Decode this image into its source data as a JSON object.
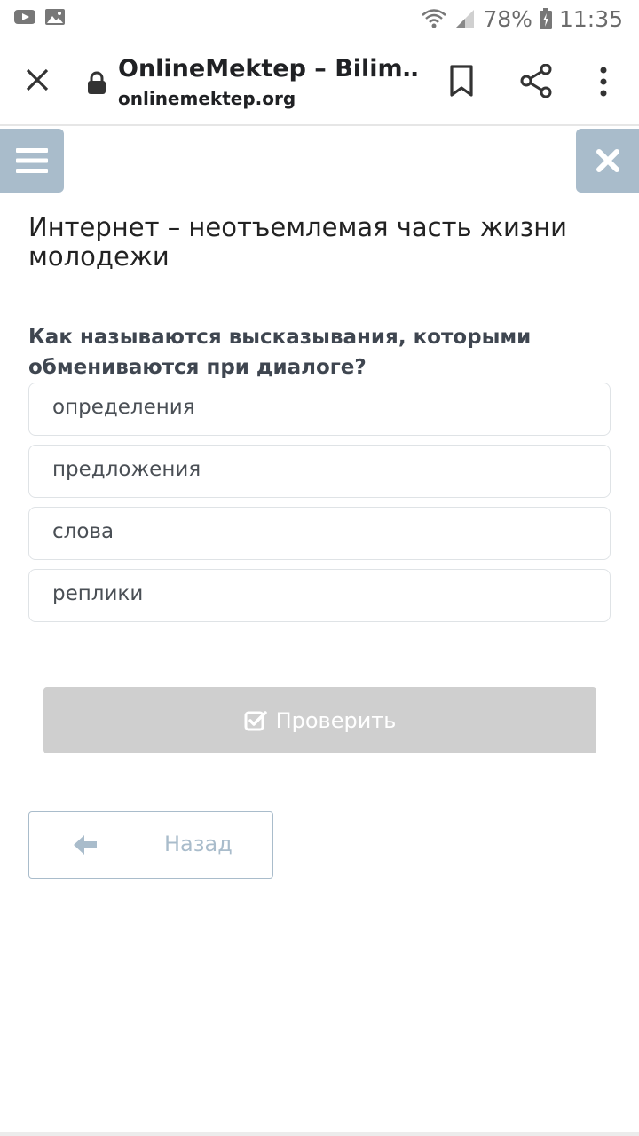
{
  "status_bar": {
    "battery": "78%",
    "time": "11:35"
  },
  "browser": {
    "title": "OnlineMektep – Bilim…",
    "url_domain": "onlinemektep",
    "url_tld": ".org"
  },
  "page": {
    "title": "Интернет – неотъемлемая часть жизни молодежи",
    "question": "Как называются высказывания, которыми обмениваются при диалоге?",
    "options": [
      {
        "label": "определения"
      },
      {
        "label": "предложения"
      },
      {
        "label": "слова"
      },
      {
        "label": "реплики"
      }
    ],
    "check_button": "Проверить",
    "back_button": "Назад"
  },
  "colors": {
    "accent": "#a9bccb",
    "disabled_button": "#cfcfcf"
  }
}
